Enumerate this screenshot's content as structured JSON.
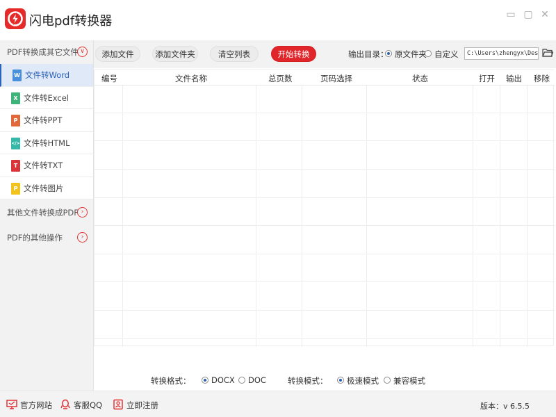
{
  "app": {
    "title": "闪电pdf转换器"
  },
  "window_controls": {
    "minimize": "▭",
    "maximize": "▢",
    "close": "✕"
  },
  "sidebar": {
    "section_pdf_to_other": "PDF转换成其它文件",
    "items": [
      {
        "label": "文件转Word",
        "icon": "W",
        "color": "#4a8fd9",
        "active": true
      },
      {
        "label": "文件转Excel",
        "icon": "X",
        "color": "#3fb47a"
      },
      {
        "label": "文件转PPT",
        "icon": "P",
        "color": "#e0683a"
      },
      {
        "label": "文件转HTML",
        "icon": "</>",
        "color": "#36b8a8"
      },
      {
        "label": "文件转TXT",
        "icon": "T",
        "color": "#d9343a"
      },
      {
        "label": "文件转图片",
        "icon": "P",
        "color": "#f2c318"
      }
    ],
    "section_other_to_pdf": "其他文件转换成PDF",
    "section_pdf_ops": "PDF的其他操作"
  },
  "toolbar": {
    "add_file": "添加文件",
    "add_folder": "添加文件夹",
    "clear_list": "清空列表",
    "start": "开始转换",
    "output_dir_label": "输出目录：",
    "opt_source_folder": "原文件夹",
    "opt_custom": "自定义",
    "path_value": "C:\\Users\\zhengyx\\Desktop\\"
  },
  "table": {
    "columns": [
      "编号",
      "文件名称",
      "总页数",
      "页码选择",
      "状态",
      "打开",
      "输出",
      "移除"
    ],
    "rows": []
  },
  "options": {
    "format_label": "转换格式：",
    "format_docx": "DOCX",
    "format_doc": "DOC",
    "mode_label": "转换模式：",
    "mode_fast": "极速模式",
    "mode_compat": "兼容模式"
  },
  "footer": {
    "website": "官方网站",
    "qq": "客服QQ",
    "register": "立即注册",
    "version": "版本：v 6.5.5"
  },
  "colors": {
    "accent_red": "#e0262b",
    "active_blue": "#2b63b8"
  }
}
